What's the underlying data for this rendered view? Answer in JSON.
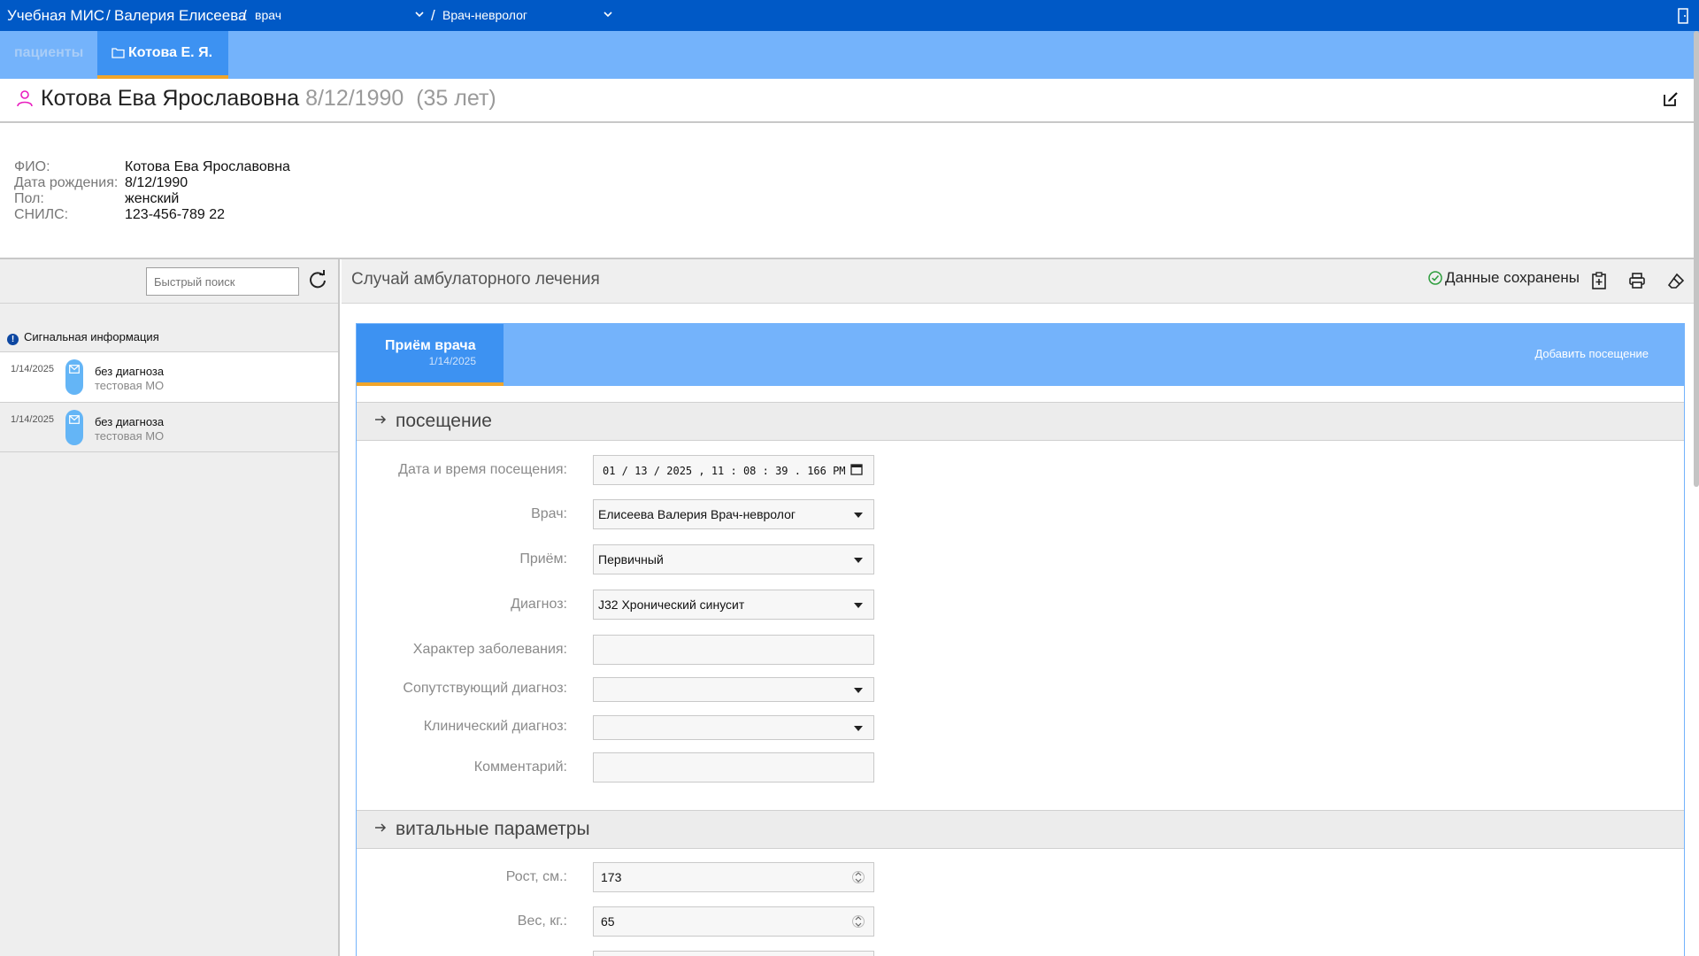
{
  "topbar": {
    "app": "Учебная МИС",
    "sep1": "/",
    "user": "Валерия Елисеева",
    "sep2": "/",
    "role": "врач",
    "sep3": "/",
    "speciality": "Врач-невролог",
    "exit_icon": "exit-door-icon"
  },
  "tabs": {
    "patients": "пациенты",
    "current": "Котова Е. Я."
  },
  "patient": {
    "full_name": "Котова Ева Ярославовна",
    "birth_date": "8/12/1990",
    "age": "(35 лет)",
    "fields": [
      {
        "label": "ФИО:",
        "value": "Котова Ева Ярославовна"
      },
      {
        "label": "Дата рождения:",
        "value": "8/12/1990"
      },
      {
        "label": "Пол:",
        "value": "женский"
      },
      {
        "label": "СНИЛС:",
        "value": "123-456-789 22"
      }
    ]
  },
  "left": {
    "search_placeholder": "Быстрый поиск",
    "signal": "Сигнальная информация",
    "visits": [
      {
        "date": "1/14/2025",
        "diagnosis": "без диагноза",
        "org": "тестовая МО"
      },
      {
        "date": "1/14/2025",
        "diagnosis": "без диагноза",
        "org": "тестовая МО"
      }
    ]
  },
  "right": {
    "title": "Случай амбулаторного лечения",
    "saved": "Данные сохранены",
    "card_tab_title": "Приём врача",
    "card_tab_date": "1/14/2025",
    "add_visit": "Добавить посещение",
    "section_visit": "посещение",
    "section_vitals": "витальные параметры",
    "form": {
      "datetime_label": "Дата и время посещения:",
      "datetime_value": "01 / 13 / 2025 ,  11 : 08 : 39 . 166   PM",
      "doctor_label": "Врач:",
      "doctor_value": "Елисеева Валерия Врач-невролог",
      "reception_label": "Приём:",
      "reception_value": "Первичный",
      "diagnosis_label": "Диагноз:",
      "diagnosis_value": "J32 Хронический синусит",
      "character_label": "Характер заболевания:",
      "character_value": "",
      "concomitant_label": "Сопутствующий диагноз:",
      "concomitant_value": "",
      "clinical_label": "Клинический диагноз:",
      "clinical_value": "",
      "comment_label": "Комментарий:",
      "comment_value": ""
    },
    "vitals": {
      "height_label": "Рост, см.:",
      "height_value": "173",
      "weight_label": "Вес, кг.:",
      "weight_value": "65"
    }
  },
  "colors": {
    "topbar": "#0059c6",
    "tabbar": "#74b3fb",
    "active_tab": "#3d92f2",
    "accent_underline": "#f0a52b",
    "saved_check": "#2e9e3e"
  }
}
